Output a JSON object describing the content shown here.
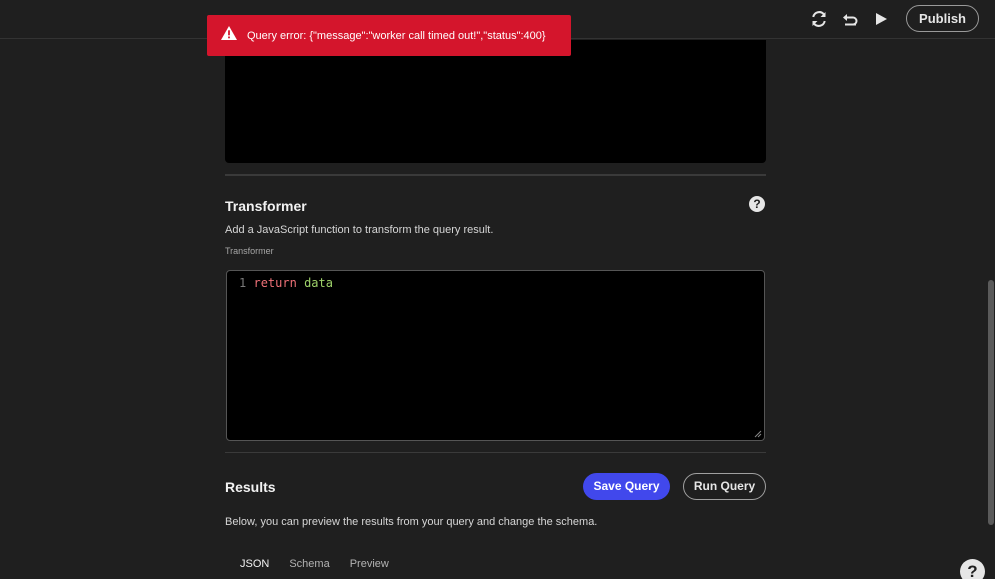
{
  "toast": {
    "message": "Query error: {\"message\":\"worker call timed out!\",\"status\":400}"
  },
  "topbar": {
    "icons": [
      "refresh-icon",
      "undo-icon",
      "play-icon"
    ],
    "publish_label": "Publish"
  },
  "transformer": {
    "title": "Transformer",
    "description": "Add a JavaScript function to transform the query result.",
    "field_label": "Transformer",
    "code": {
      "line_number": "1",
      "keyword": "return",
      "identifier": "data"
    }
  },
  "results": {
    "title": "Results",
    "save_label": "Save Query",
    "run_label": "Run Query",
    "description": "Below, you can preview the results from your query and change the schema.",
    "tabs": [
      "JSON",
      "Schema",
      "Preview"
    ],
    "active_tab": "JSON"
  },
  "help": {
    "glyph": "?"
  },
  "colors": {
    "toast_bg": "#d4152c",
    "primary_button": "#4148ec",
    "background": "#1f1f1f",
    "editor_bg": "#000000"
  }
}
